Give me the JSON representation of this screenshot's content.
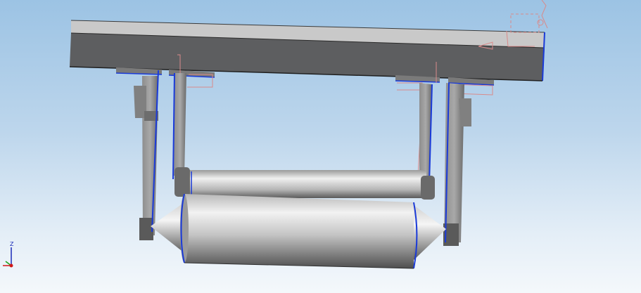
{
  "scene": {
    "model": "roller-frame-assembly",
    "colors": {
      "background_top": "#9cc3e4",
      "background_bottom": "#f4f8fb",
      "beam_top": "#c7c7c7",
      "beam_side": "#5f6062",
      "edge_highlight": "#1a3ad8",
      "sketch_lines": "#d98a8a",
      "roller_light": "#e8e8e8",
      "roller_dark": "#4a4a4a"
    }
  },
  "triad": {
    "z_label": "Z",
    "x_axis_color": "#d01818",
    "y_axis_color": "#18a018",
    "z_axis_color": "#1b2bb8"
  }
}
